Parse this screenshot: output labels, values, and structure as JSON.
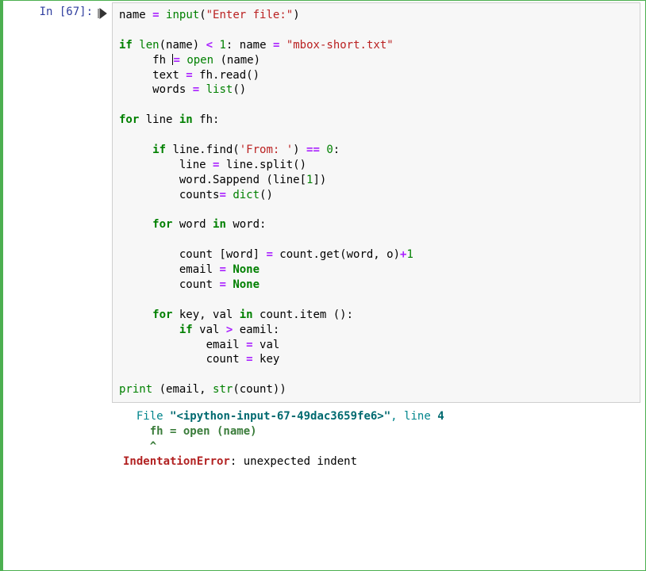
{
  "prompt": "In [67]:",
  "code": {
    "l01": {
      "a": "name ",
      "b": "=",
      "c": " ",
      "d": "input",
      "e": "(",
      "f": "\"Enter file:\"",
      "g": ")"
    },
    "l03": {
      "a": "if",
      "b": " ",
      "c": "len",
      "d": "(name) ",
      "e": "<",
      "f": " ",
      "g": "1",
      "h": ": name ",
      "i": "=",
      "j": " ",
      "k": "\"mbox-short.txt\""
    },
    "l04": {
      "a": "     fh ",
      "b": "=",
      "c": " ",
      "d": "open",
      "e": " (name)"
    },
    "l05": {
      "a": "     text ",
      "b": "=",
      "c": " fh.read()"
    },
    "l06": {
      "a": "     words ",
      "b": "=",
      "c": " ",
      "d": "list",
      "e": "()"
    },
    "l08": {
      "a": "for",
      "b": " line ",
      "c": "in",
      "d": " fh:"
    },
    "l10": {
      "a": "     ",
      "b": "if",
      "c": " line.find(",
      "d": "'From: '",
      "e": ") ",
      "f": "==",
      "g": " ",
      "h": "0",
      "i": ":"
    },
    "l11": {
      "a": "         line ",
      "b": "=",
      "c": " line.split()"
    },
    "l12": {
      "a": "         word.Sappend (line[",
      "b": "1",
      "c": "])"
    },
    "l13": {
      "a": "         counts",
      "b": "=",
      "c": " ",
      "d": "dict",
      "e": "()"
    },
    "l15": {
      "a": "     ",
      "b": "for",
      "c": " word ",
      "d": "in",
      "e": " word:"
    },
    "l17": {
      "a": "         count [word] ",
      "b": "=",
      "c": " count.get(word, o)",
      "d": "+",
      "e": "1"
    },
    "l18": {
      "a": "         email ",
      "b": "=",
      "c": " ",
      "d": "None"
    },
    "l19": {
      "a": "         count ",
      "b": "=",
      "c": " ",
      "d": "None"
    },
    "l21": {
      "a": "     ",
      "b": "for",
      "c": " key, val ",
      "d": "in",
      "e": " count.item ():"
    },
    "l22": {
      "a": "         ",
      "b": "if",
      "c": " val ",
      "d": ">",
      "e": " eamil:"
    },
    "l23": {
      "a": "             email ",
      "b": "=",
      "c": " val"
    },
    "l24": {
      "a": "             count ",
      "b": "=",
      "c": " key"
    },
    "l26": {
      "a": "print",
      "b": " (email, ",
      "c": "str",
      "d": "(count))"
    }
  },
  "output": {
    "l1a": "  File ",
    "l1b": "\"<ipython-input-67-49dac3659fe6>\"",
    "l1c": ", line ",
    "l1d": "4",
    "l2": "    fh = open (name)",
    "l3": "    ^",
    "l4a": "IndentationError",
    "l4b": ": unexpected indent"
  }
}
